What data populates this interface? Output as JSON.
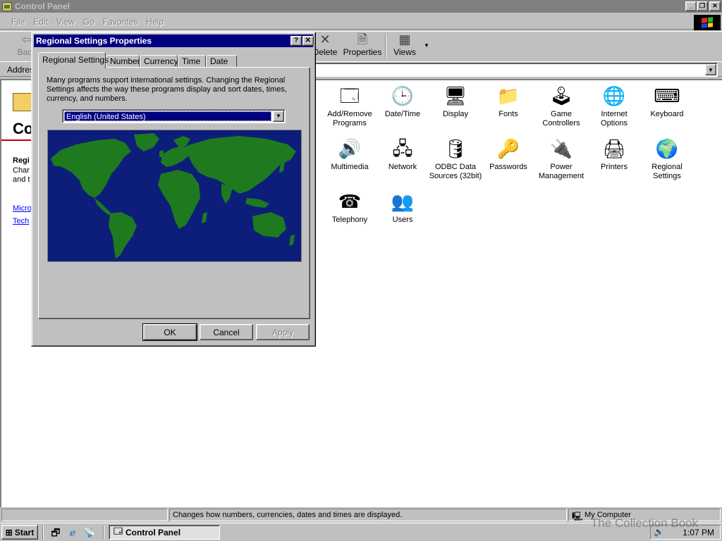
{
  "window": {
    "title": "Control Panel"
  },
  "menu": [
    "File",
    "Edit",
    "View",
    "Go",
    "Favorites",
    "Help"
  ],
  "toolbar": {
    "back": "Back",
    "delete": "Delete",
    "properties": "Properties",
    "views": "Views"
  },
  "address": {
    "label": "Address"
  },
  "webview": {
    "title": "Co",
    "subtitle": "Regi",
    "line1": "Char",
    "line2": "and t",
    "link1": "Micro",
    "link2": "Tech"
  },
  "items": [
    {
      "label": "Add/Remove Programs",
      "icon": "add-remove-programs-icon",
      "glyph": "🗔"
    },
    {
      "label": "Date/Time",
      "icon": "date-time-icon",
      "glyph": "🕒"
    },
    {
      "label": "Display",
      "icon": "display-icon",
      "glyph": "🖥"
    },
    {
      "label": "Fonts",
      "icon": "fonts-folder-icon",
      "glyph": "📁"
    },
    {
      "label": "Game Controllers",
      "icon": "joystick-icon",
      "glyph": "🕹"
    },
    {
      "label": "Internet Options",
      "icon": "internet-options-icon",
      "glyph": "🌐"
    },
    {
      "label": "Keyboard",
      "icon": "keyboard-icon",
      "glyph": "⌨"
    },
    {
      "label": "Multimedia",
      "icon": "multimedia-icon",
      "glyph": "🔊"
    },
    {
      "label": "Network",
      "icon": "network-icon",
      "glyph": "🖧"
    },
    {
      "label": "ODBC Data Sources (32bit)",
      "icon": "odbc-icon",
      "glyph": "🛢"
    },
    {
      "label": "Passwords",
      "icon": "keys-icon",
      "glyph": "🔑"
    },
    {
      "label": "Power Management",
      "icon": "power-management-icon",
      "glyph": "🔌"
    },
    {
      "label": "Printers",
      "icon": "printers-folder-icon",
      "glyph": "🖨"
    },
    {
      "label": "Regional Settings",
      "icon": "globe-icon",
      "glyph": "🌍"
    },
    {
      "label": "Telephony",
      "icon": "telephone-icon",
      "glyph": "☎"
    },
    {
      "label": "Users",
      "icon": "users-icon",
      "glyph": "👥"
    }
  ],
  "status": {
    "text": "Changes how numbers, currencies, dates and times are displayed.",
    "zone": "My Computer"
  },
  "dialog": {
    "title": "Regional Settings Properties",
    "tabs": [
      "Regional Settings",
      "Number",
      "Currency",
      "Time",
      "Date"
    ],
    "description": "Many programs support international settings. Changing the Regional Settings affects the way these programs display and sort dates, times, currency, and numbers.",
    "locale": "English (United States)",
    "ok": "OK",
    "cancel": "Cancel",
    "apply": "Apply",
    "help_glyph": "?",
    "close_glyph": "✕"
  },
  "taskbar": {
    "start": "Start",
    "task": "Control Panel",
    "clock": "1:07 PM"
  },
  "watermark": "The Collection Book",
  "colors": {
    "active_title": "#000080",
    "inactive_title": "#808080",
    "map_ocean": "#0c1e7a",
    "map_land": "#1f7a1f"
  }
}
